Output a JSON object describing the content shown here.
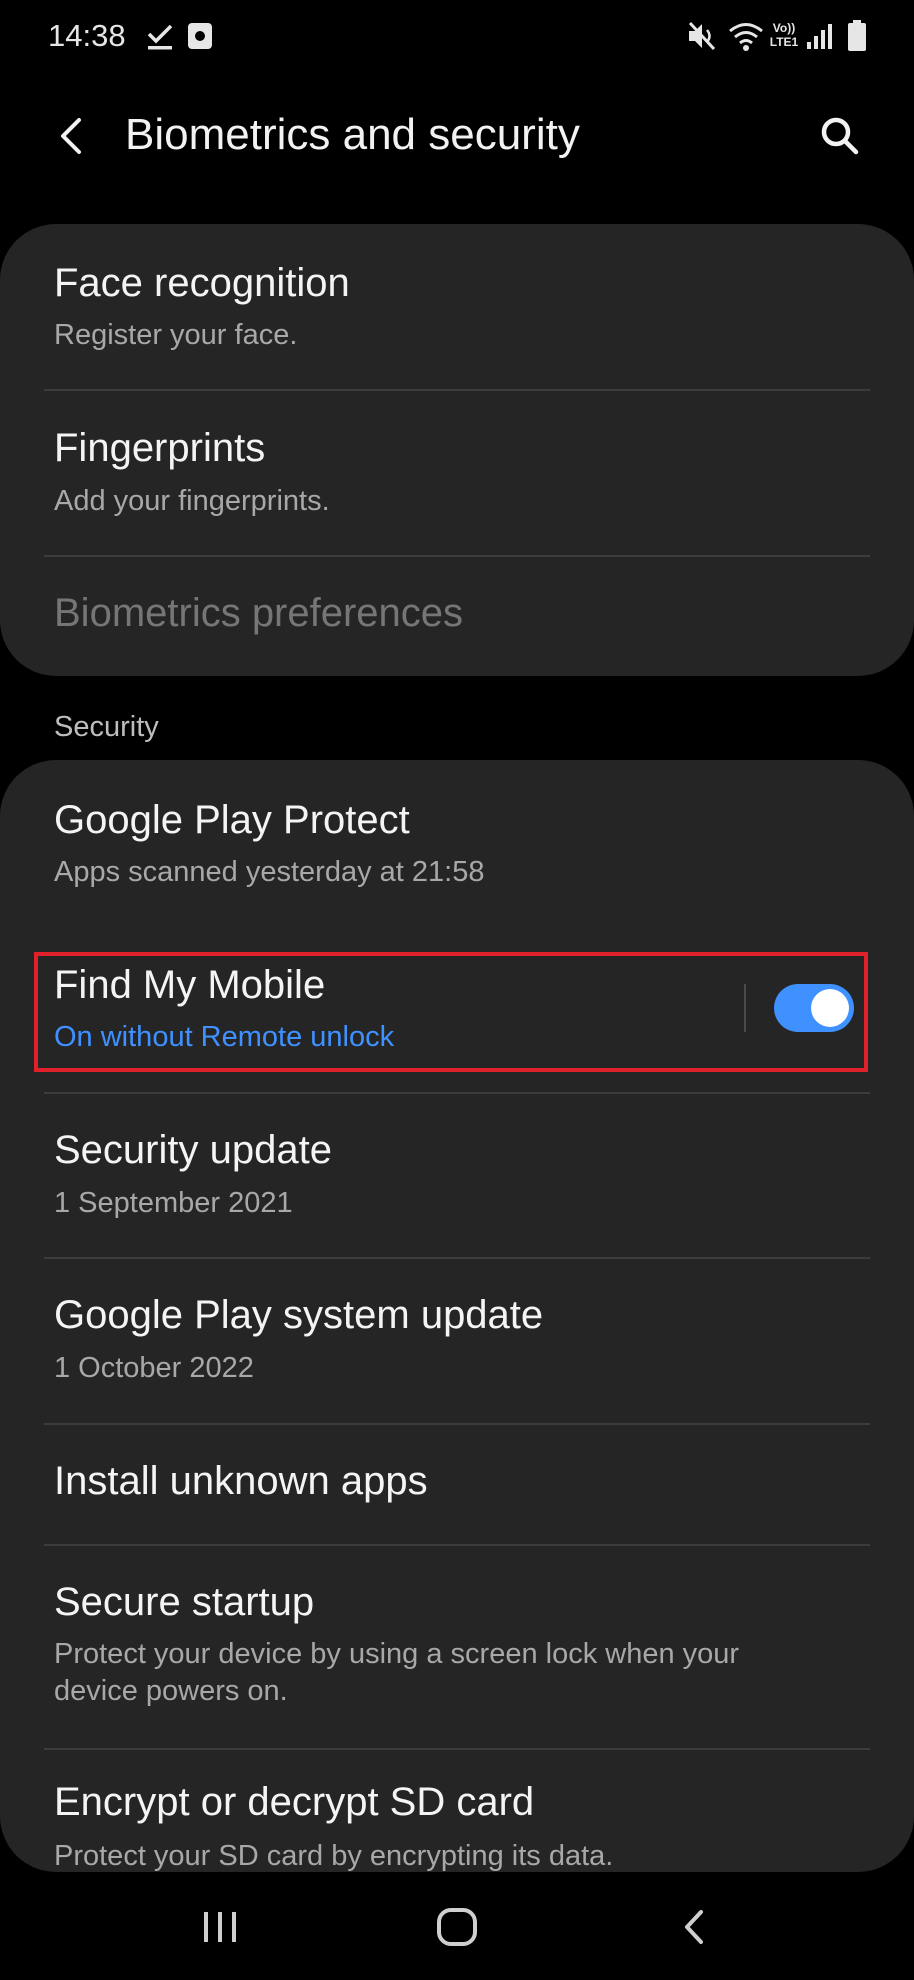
{
  "status_bar": {
    "time": "14:38",
    "icons": [
      "download-done-icon",
      "screenshot-icon",
      "mute-icon",
      "wifi-icon",
      "volte-icon",
      "signal-icon",
      "battery-icon"
    ],
    "volte_text_top": "Vo))",
    "volte_text_bottom": "LTE1"
  },
  "app_bar": {
    "title": "Biometrics and security",
    "back_icon": "back-arrow-icon",
    "search_icon": "search-icon"
  },
  "biometrics": {
    "items": [
      {
        "title": "Face recognition",
        "subtitle": "Register your face."
      },
      {
        "title": "Fingerprints",
        "subtitle": "Add your fingerprints."
      },
      {
        "title": "Biometrics preferences",
        "disabled": true
      }
    ]
  },
  "security": {
    "header": "Security",
    "items": [
      {
        "title": "Google Play Protect",
        "subtitle": "Apps scanned yesterday at 21:58"
      },
      {
        "title": "Find My Mobile",
        "subtitle": "On without Remote unlock",
        "toggle_on": true,
        "highlighted": true
      },
      {
        "title": "Security update",
        "subtitle": "1 September 2021"
      },
      {
        "title": "Google Play system update",
        "subtitle": "1 October 2022"
      },
      {
        "title": "Install unknown apps"
      },
      {
        "title": "Secure startup",
        "subtitle_line1": "Protect your device by using a screen lock when your",
        "subtitle_line2": "device powers on."
      },
      {
        "title": "Encrypt or decrypt SD card",
        "subtitle": "Protect your SD card by encrypting its data."
      }
    ]
  },
  "nav_bar": {
    "icons": [
      "recents-icon",
      "home-icon",
      "back-icon"
    ]
  },
  "colors": {
    "background": "#000000",
    "card": "#252525",
    "accent": "#3e91ff",
    "highlight": "#e0202a"
  }
}
